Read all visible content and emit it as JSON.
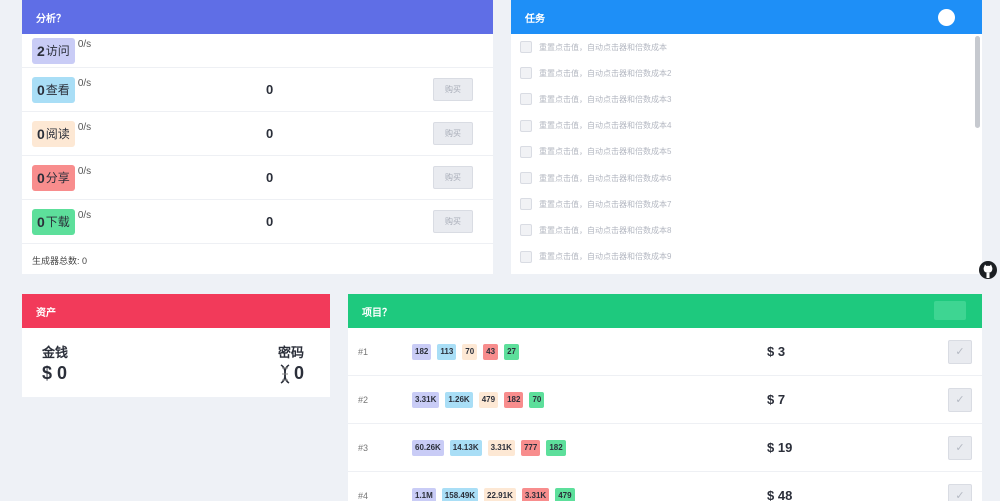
{
  "analysis": {
    "title": "分析？",
    "generators": [
      {
        "num": "2",
        "label": "访问",
        "rate": "0/s",
        "count": "",
        "buy": "",
        "color": "#c9ccf6"
      },
      {
        "num": "0",
        "label": "查看",
        "rate": "0/s",
        "count": "0",
        "buy": "购买",
        "color": "#a9def6"
      },
      {
        "num": "0",
        "label": "阅读",
        "rate": "0/s",
        "count": "0",
        "buy": "购买",
        "color": "#fde8d4"
      },
      {
        "num": "0",
        "label": "分享",
        "rate": "0/s",
        "count": "0",
        "buy": "购买",
        "color": "#f88d8d"
      },
      {
        "num": "0",
        "label": "下载",
        "rate": "0/s",
        "count": "0",
        "buy": "购买",
        "color": "#5ddf9b"
      }
    ],
    "total": "生成器总数: 0"
  },
  "tasks": {
    "title": "任务",
    "items": [
      "重置点击值，自动点击器和倍数成本",
      "重置点击值，自动点击器和倍数成本2",
      "重置点击值，自动点击器和倍数成本3",
      "重置点击值，自动点击器和倍数成本4",
      "重置点击值，自动点击器和倍数成本5",
      "重置点击值，自动点击器和倍数成本6",
      "重置点击值，自动点击器和倍数成本7",
      "重置点击值，自动点击器和倍数成本8",
      "重置点击值，自动点击器和倍数成本9"
    ]
  },
  "assets": {
    "title": "资产",
    "money_label": "金钱",
    "money_value": "$ 0",
    "code_label": "密码",
    "code_value": "0",
    "code_icon": "dna-icon"
  },
  "projects": {
    "title": "项目？",
    "rows": [
      {
        "idx": "#1",
        "chips": [
          "182",
          "113",
          "70",
          "43",
          "27"
        ],
        "cost": "$ 3"
      },
      {
        "idx": "#2",
        "chips": [
          "3.31K",
          "1.26K",
          "479",
          "182",
          "70"
        ],
        "cost": "$ 7"
      },
      {
        "idx": "#3",
        "chips": [
          "60.26K",
          "14.13K",
          "3.31K",
          "777",
          "182"
        ],
        "cost": "$ 19"
      },
      {
        "idx": "#4",
        "chips": [
          "1.1M",
          "158.49K",
          "22.91K",
          "3.31K",
          "479"
        ],
        "cost": "$ 48"
      }
    ],
    "chip_colors": [
      "#c9ccf6",
      "#a9def6",
      "#fde8d4",
      "#f88d8d",
      "#5ddf9b"
    ]
  },
  "side_icon": "github-icon"
}
